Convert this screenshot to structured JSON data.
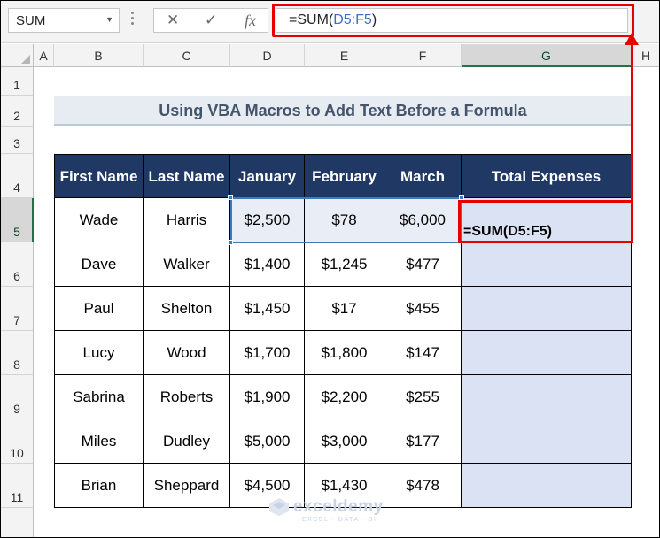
{
  "formula_bar": {
    "name_box": "SUM",
    "name_box_arrow": "▼",
    "cancel_icon": "✕",
    "enter_icon": "✓",
    "fx_label": "fx",
    "formula_prefix": "=SUM(",
    "formula_ref": "D5:F5",
    "formula_suffix": ")"
  },
  "columns": [
    "A",
    "B",
    "C",
    "D",
    "E",
    "F",
    "G",
    "H"
  ],
  "rows": [
    "1",
    "2",
    "3",
    "4",
    "5",
    "6",
    "7",
    "8",
    "9",
    "10",
    "11"
  ],
  "title": "Using VBA Macros to Add Text Before a Formula",
  "table": {
    "headers": [
      "First Name",
      "Last Name",
      "January",
      "February",
      "March",
      "Total Expenses"
    ],
    "rows": [
      [
        "Wade",
        "Harris",
        "$2,500",
        "$78",
        "$6,000",
        "=SUM(D5:F5)"
      ],
      [
        "Dave",
        "Walker",
        "$1,400",
        "$1,245",
        "$477",
        ""
      ],
      [
        "Paul",
        "Shelton",
        "$1,450",
        "$17",
        "$455",
        ""
      ],
      [
        "Lucy",
        "Wood",
        "$1,700",
        "$1,800",
        "$147",
        ""
      ],
      [
        "Sabrina",
        "Roberts",
        "$1,900",
        "$2,200",
        "$255",
        ""
      ],
      [
        "Miles",
        "Dudley",
        "$5,000",
        "$3,000",
        "$177",
        ""
      ],
      [
        "Brian",
        "Sheppard",
        "$4,500",
        "$1,430",
        "$478",
        ""
      ]
    ]
  },
  "watermark": {
    "brand": "exceldemy",
    "tagline": "EXCEL · DATA · BI"
  },
  "colors": {
    "header_fill": "#203864",
    "title_fill": "#e7ecf3",
    "highlight_fill": "#dae2f3",
    "annotation_red": "#e60000",
    "selection_blue": "#3d7bbf"
  }
}
